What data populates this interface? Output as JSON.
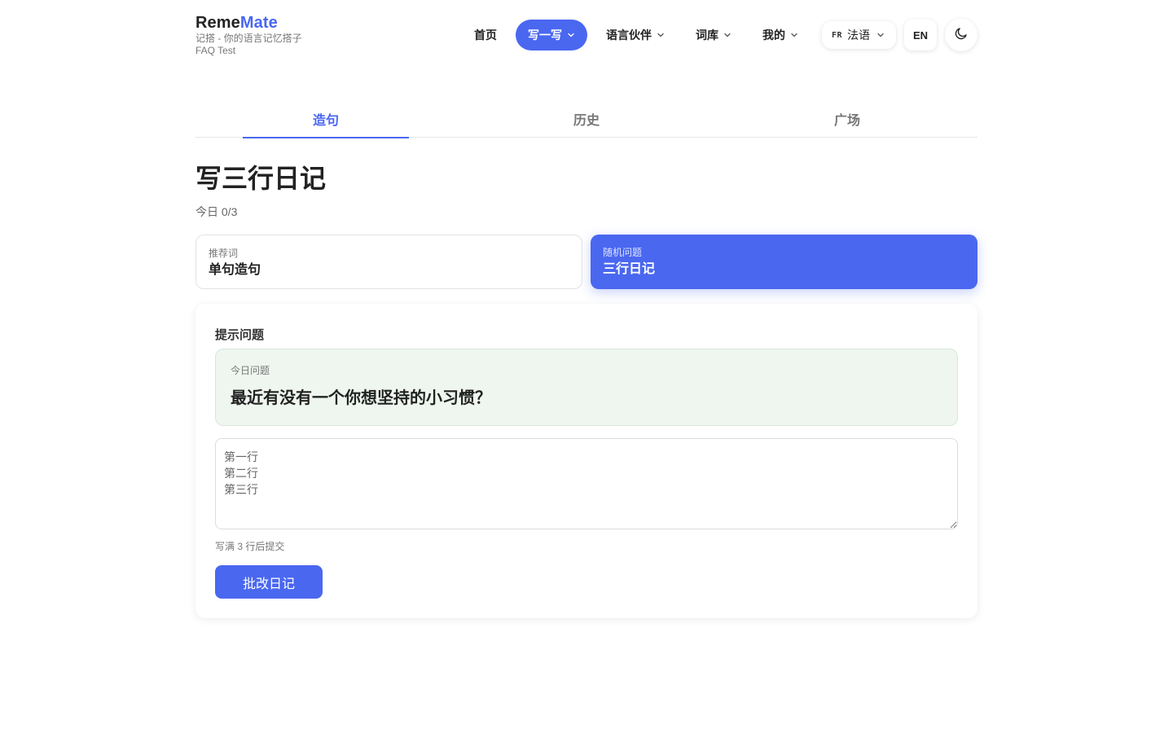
{
  "brand": {
    "name_part1": "Reme",
    "name_part2": "Mate",
    "tagline": "记搭 - 你的语言记忆搭子",
    "subtitle": "FAQ Test",
    "accent_color": "#4a67f0"
  },
  "nav": {
    "items": [
      {
        "label": "首页",
        "has_dropdown": false,
        "active": false
      },
      {
        "label": "写一写",
        "has_dropdown": true,
        "active": true
      },
      {
        "label": "语言伙伴",
        "has_dropdown": true,
        "active": false
      },
      {
        "label": "词库",
        "has_dropdown": true,
        "active": false
      },
      {
        "label": "我的",
        "has_dropdown": true,
        "active": false
      }
    ],
    "language": {
      "code": "FR",
      "label": "法语"
    },
    "ui_language": "EN",
    "theme_icon": "moon-icon"
  },
  "tabs": [
    {
      "label": "造句",
      "active": true
    },
    {
      "label": "历史",
      "active": false
    },
    {
      "label": "广场",
      "active": false
    }
  ],
  "page": {
    "title": "写三行日记",
    "today_progress": "今日 0/3"
  },
  "modes": {
    "left": {
      "label": "推荐词",
      "title": "单句造句",
      "selected": false
    },
    "right": {
      "label": "随机问题",
      "title": "三行日记",
      "selected": true
    }
  },
  "prompt_card": {
    "heading": "提示问题",
    "question_label": "今日问题",
    "question_text": "最近有没有一个你想坚持的小习惯？",
    "answer_placeholder": "第一行\n第二行\n第三行",
    "hint": "写满 3 行后提交",
    "submit_label": "批改日记"
  }
}
